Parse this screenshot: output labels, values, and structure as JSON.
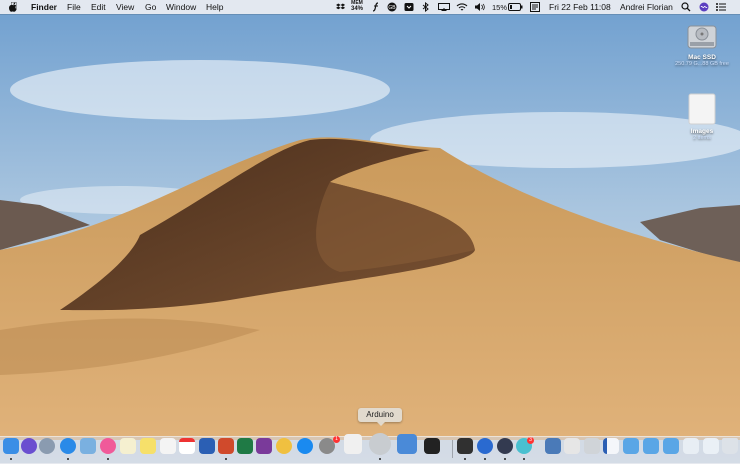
{
  "menubar": {
    "apple": "",
    "app_name": "Finder",
    "menus": [
      "File",
      "Edit",
      "View",
      "Go",
      "Window",
      "Help"
    ],
    "mem_label": "MEM",
    "mem_value": "34%",
    "battery_percent": "15%",
    "datetime": "Fri 22 Feb  11:08",
    "user": "Andrei Florian"
  },
  "desktop": {
    "drive": {
      "label": "Mac SSD",
      "info": "250.79 G...88 GB free"
    },
    "folder": {
      "label": "Images",
      "info": "2 items"
    }
  },
  "dock": {
    "tooltip": "Arduino",
    "colors": {
      "finder": "#3a8ee6",
      "siri": "#6a4fd0",
      "launchpad": "#8a9bb0",
      "safari": "#2a8ae8",
      "preview": "#7ab0e0",
      "itunes": "#f05a9a",
      "notes": "#f5f0d0",
      "stickies": "#f6e06a",
      "reminders": "#f4f4f4",
      "calendar": "#ffffff",
      "word": "#2b5fb4",
      "powerpoint": "#d04a2c",
      "excel": "#1f7a45",
      "onenote": "#7a3a9a",
      "photos": "#f0c040",
      "appstore": "#1a8af0",
      "sysprefs": "#8a8a8a",
      "textedit": "#f0f0f0",
      "arduino": "#c8ccd0",
      "xcode": "#4a8ad8",
      "terminal": "#222222",
      "monitor": "#303030",
      "sourcetree": "#2a6ad0",
      "quicktime": "#333a50",
      "messages": "#4ac0d0"
    },
    "badges": {
      "sysprefs": "1",
      "messages": "3"
    }
  }
}
